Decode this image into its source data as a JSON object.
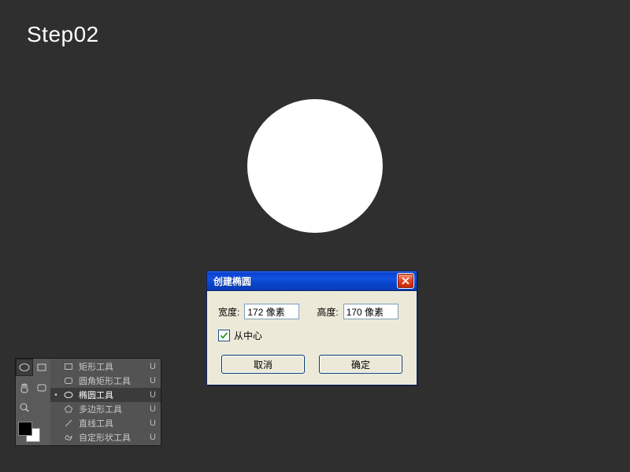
{
  "step_label": "Step02",
  "dialog": {
    "title": "创建椭圆",
    "width_label": "宽度:",
    "width_value": "172 像素",
    "height_label": "高度:",
    "height_value": "170 像素",
    "from_center_label": "从中心",
    "from_center_checked": true,
    "cancel": "取消",
    "ok": "确定"
  },
  "shape_tools": [
    {
      "label": "矩形工具",
      "key": "U",
      "selected": false
    },
    {
      "label": "圆角矩形工具",
      "key": "U",
      "selected": false
    },
    {
      "label": "椭圆工具",
      "key": "U",
      "selected": true
    },
    {
      "label": "多边形工具",
      "key": "U",
      "selected": false
    },
    {
      "label": "直线工具",
      "key": "U",
      "selected": false
    },
    {
      "label": "自定形状工具",
      "key": "U",
      "selected": false
    }
  ]
}
